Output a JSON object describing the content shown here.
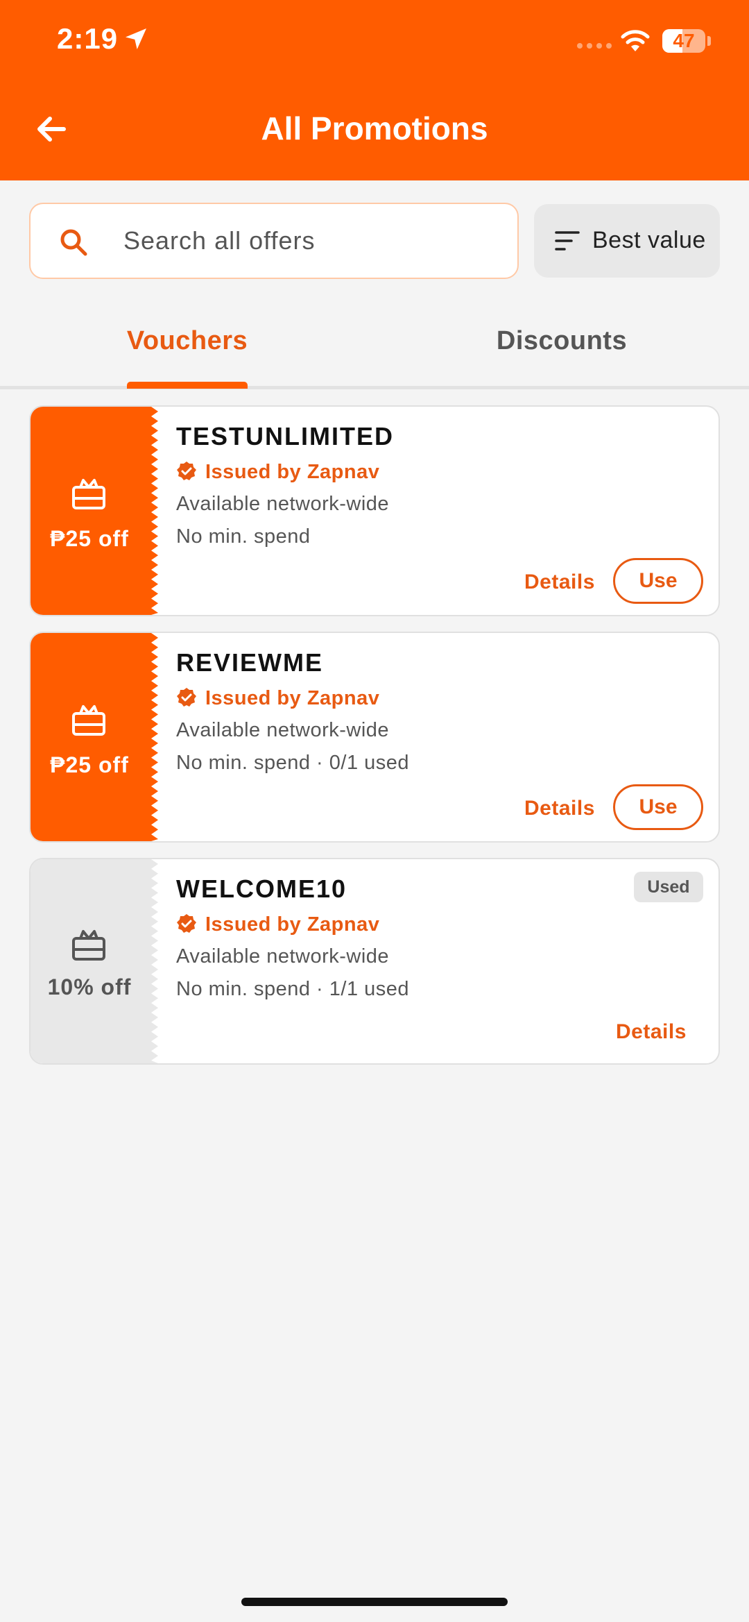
{
  "status_bar": {
    "time": "2:19",
    "battery": "47",
    "battery_level": 0.47
  },
  "header": {
    "title": "All Promotions",
    "back_icon": "arrow-left-icon"
  },
  "search": {
    "placeholder": "Search all offers",
    "value": ""
  },
  "sort": {
    "label": "Best value"
  },
  "tabs": [
    {
      "label": "Vouchers",
      "selected": true
    },
    {
      "label": "Discounts",
      "selected": false
    }
  ],
  "vouchers": [
    {
      "amount": "₱25 off",
      "code": "TESTUNLIMITED",
      "issuer": "Issued by Zapnav",
      "availability": "Available network-wide",
      "terms": "No min. spend",
      "details_label": "Details",
      "use_label": "Use",
      "state": "active"
    },
    {
      "amount": "₱25 off",
      "code": "REVIEWME",
      "issuer": "Issued by Zapnav",
      "availability": "Available network-wide",
      "terms": "No min. spend · 0/1 used",
      "details_label": "Details",
      "use_label": "Use",
      "state": "active"
    },
    {
      "amount": "10% off",
      "code": "WELCOME10",
      "issuer": "Issued by Zapnav",
      "availability": "Available network-wide",
      "terms": "No min. spend · 1/1 used",
      "details_label": "Details",
      "badge": "Used",
      "state": "used"
    }
  ],
  "colors": {
    "brand": "#ff5c00",
    "accent_text": "#e85a12",
    "background": "#f4f4f4"
  }
}
